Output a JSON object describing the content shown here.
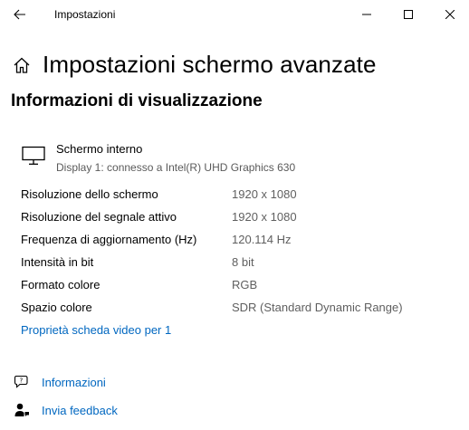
{
  "window": {
    "title": "Impostazioni"
  },
  "header": {
    "title": "Impostazioni schermo avanzate"
  },
  "section": {
    "title": "Informazioni di visualizzazione"
  },
  "display": {
    "name": "Schermo interno",
    "description": "Display 1: connesso a Intel(R) UHD Graphics 630"
  },
  "properties": [
    {
      "label": "Risoluzione dello schermo",
      "value": "1920 x 1080"
    },
    {
      "label": "Risoluzione del segnale attivo",
      "value": "1920 x 1080"
    },
    {
      "label": "Frequenza di aggiornamento (Hz)",
      "value": "120.114 Hz"
    },
    {
      "label": "Intensità in bit",
      "value": "8 bit"
    },
    {
      "label": "Formato colore",
      "value": "RGB"
    },
    {
      "label": "Spazio colore",
      "value": "SDR (Standard Dynamic Range)"
    }
  ],
  "links": {
    "adapter_properties": "Proprietà scheda video per 1",
    "info": "Informazioni",
    "feedback": "Invia feedback"
  },
  "icons": {
    "back": "back-arrow-icon",
    "home": "home-icon",
    "monitor": "monitor-icon",
    "info": "chat-help-icon",
    "feedback": "feedback-person-icon"
  },
  "colors": {
    "link": "#0067c0",
    "secondary_text": "#5f5f5f"
  }
}
